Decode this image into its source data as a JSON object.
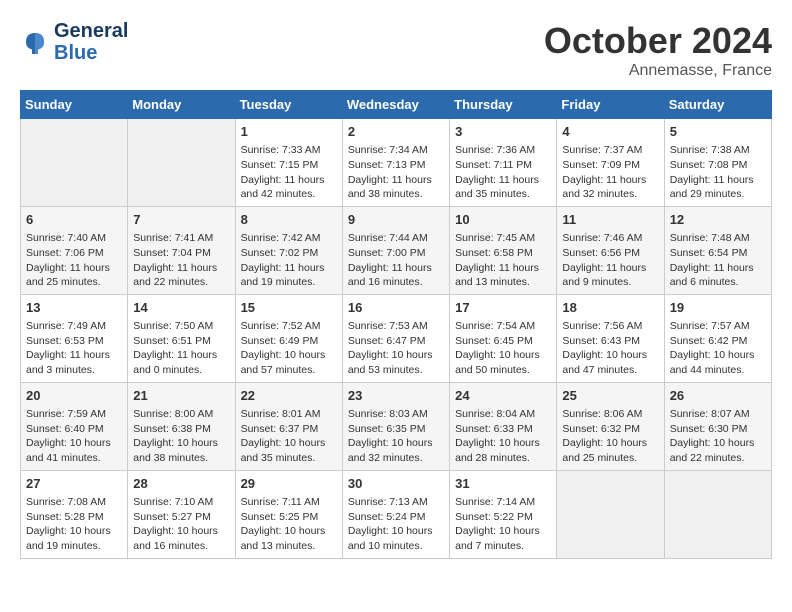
{
  "header": {
    "logo_line1": "General",
    "logo_line2": "Blue",
    "month": "October 2024",
    "location": "Annemasse, France"
  },
  "days_of_week": [
    "Sunday",
    "Monday",
    "Tuesday",
    "Wednesday",
    "Thursday",
    "Friday",
    "Saturday"
  ],
  "weeks": [
    [
      {
        "day": "",
        "empty": true
      },
      {
        "day": "",
        "empty": true
      },
      {
        "day": "1",
        "sunrise": "Sunrise: 7:33 AM",
        "sunset": "Sunset: 7:15 PM",
        "daylight": "Daylight: 11 hours and 42 minutes."
      },
      {
        "day": "2",
        "sunrise": "Sunrise: 7:34 AM",
        "sunset": "Sunset: 7:13 PM",
        "daylight": "Daylight: 11 hours and 38 minutes."
      },
      {
        "day": "3",
        "sunrise": "Sunrise: 7:36 AM",
        "sunset": "Sunset: 7:11 PM",
        "daylight": "Daylight: 11 hours and 35 minutes."
      },
      {
        "day": "4",
        "sunrise": "Sunrise: 7:37 AM",
        "sunset": "Sunset: 7:09 PM",
        "daylight": "Daylight: 11 hours and 32 minutes."
      },
      {
        "day": "5",
        "sunrise": "Sunrise: 7:38 AM",
        "sunset": "Sunset: 7:08 PM",
        "daylight": "Daylight: 11 hours and 29 minutes."
      }
    ],
    [
      {
        "day": "6",
        "sunrise": "Sunrise: 7:40 AM",
        "sunset": "Sunset: 7:06 PM",
        "daylight": "Daylight: 11 hours and 25 minutes."
      },
      {
        "day": "7",
        "sunrise": "Sunrise: 7:41 AM",
        "sunset": "Sunset: 7:04 PM",
        "daylight": "Daylight: 11 hours and 22 minutes."
      },
      {
        "day": "8",
        "sunrise": "Sunrise: 7:42 AM",
        "sunset": "Sunset: 7:02 PM",
        "daylight": "Daylight: 11 hours and 19 minutes."
      },
      {
        "day": "9",
        "sunrise": "Sunrise: 7:44 AM",
        "sunset": "Sunset: 7:00 PM",
        "daylight": "Daylight: 11 hours and 16 minutes."
      },
      {
        "day": "10",
        "sunrise": "Sunrise: 7:45 AM",
        "sunset": "Sunset: 6:58 PM",
        "daylight": "Daylight: 11 hours and 13 minutes."
      },
      {
        "day": "11",
        "sunrise": "Sunrise: 7:46 AM",
        "sunset": "Sunset: 6:56 PM",
        "daylight": "Daylight: 11 hours and 9 minutes."
      },
      {
        "day": "12",
        "sunrise": "Sunrise: 7:48 AM",
        "sunset": "Sunset: 6:54 PM",
        "daylight": "Daylight: 11 hours and 6 minutes."
      }
    ],
    [
      {
        "day": "13",
        "sunrise": "Sunrise: 7:49 AM",
        "sunset": "Sunset: 6:53 PM",
        "daylight": "Daylight: 11 hours and 3 minutes."
      },
      {
        "day": "14",
        "sunrise": "Sunrise: 7:50 AM",
        "sunset": "Sunset: 6:51 PM",
        "daylight": "Daylight: 11 hours and 0 minutes."
      },
      {
        "day": "15",
        "sunrise": "Sunrise: 7:52 AM",
        "sunset": "Sunset: 6:49 PM",
        "daylight": "Daylight: 10 hours and 57 minutes."
      },
      {
        "day": "16",
        "sunrise": "Sunrise: 7:53 AM",
        "sunset": "Sunset: 6:47 PM",
        "daylight": "Daylight: 10 hours and 53 minutes."
      },
      {
        "day": "17",
        "sunrise": "Sunrise: 7:54 AM",
        "sunset": "Sunset: 6:45 PM",
        "daylight": "Daylight: 10 hours and 50 minutes."
      },
      {
        "day": "18",
        "sunrise": "Sunrise: 7:56 AM",
        "sunset": "Sunset: 6:43 PM",
        "daylight": "Daylight: 10 hours and 47 minutes."
      },
      {
        "day": "19",
        "sunrise": "Sunrise: 7:57 AM",
        "sunset": "Sunset: 6:42 PM",
        "daylight": "Daylight: 10 hours and 44 minutes."
      }
    ],
    [
      {
        "day": "20",
        "sunrise": "Sunrise: 7:59 AM",
        "sunset": "Sunset: 6:40 PM",
        "daylight": "Daylight: 10 hours and 41 minutes."
      },
      {
        "day": "21",
        "sunrise": "Sunrise: 8:00 AM",
        "sunset": "Sunset: 6:38 PM",
        "daylight": "Daylight: 10 hours and 38 minutes."
      },
      {
        "day": "22",
        "sunrise": "Sunrise: 8:01 AM",
        "sunset": "Sunset: 6:37 PM",
        "daylight": "Daylight: 10 hours and 35 minutes."
      },
      {
        "day": "23",
        "sunrise": "Sunrise: 8:03 AM",
        "sunset": "Sunset: 6:35 PM",
        "daylight": "Daylight: 10 hours and 32 minutes."
      },
      {
        "day": "24",
        "sunrise": "Sunrise: 8:04 AM",
        "sunset": "Sunset: 6:33 PM",
        "daylight": "Daylight: 10 hours and 28 minutes."
      },
      {
        "day": "25",
        "sunrise": "Sunrise: 8:06 AM",
        "sunset": "Sunset: 6:32 PM",
        "daylight": "Daylight: 10 hours and 25 minutes."
      },
      {
        "day": "26",
        "sunrise": "Sunrise: 8:07 AM",
        "sunset": "Sunset: 6:30 PM",
        "daylight": "Daylight: 10 hours and 22 minutes."
      }
    ],
    [
      {
        "day": "27",
        "sunrise": "Sunrise: 7:08 AM",
        "sunset": "Sunset: 5:28 PM",
        "daylight": "Daylight: 10 hours and 19 minutes."
      },
      {
        "day": "28",
        "sunrise": "Sunrise: 7:10 AM",
        "sunset": "Sunset: 5:27 PM",
        "daylight": "Daylight: 10 hours and 16 minutes."
      },
      {
        "day": "29",
        "sunrise": "Sunrise: 7:11 AM",
        "sunset": "Sunset: 5:25 PM",
        "daylight": "Daylight: 10 hours and 13 minutes."
      },
      {
        "day": "30",
        "sunrise": "Sunrise: 7:13 AM",
        "sunset": "Sunset: 5:24 PM",
        "daylight": "Daylight: 10 hours and 10 minutes."
      },
      {
        "day": "31",
        "sunrise": "Sunrise: 7:14 AM",
        "sunset": "Sunset: 5:22 PM",
        "daylight": "Daylight: 10 hours and 7 minutes."
      },
      {
        "day": "",
        "empty": true
      },
      {
        "day": "",
        "empty": true
      }
    ]
  ]
}
